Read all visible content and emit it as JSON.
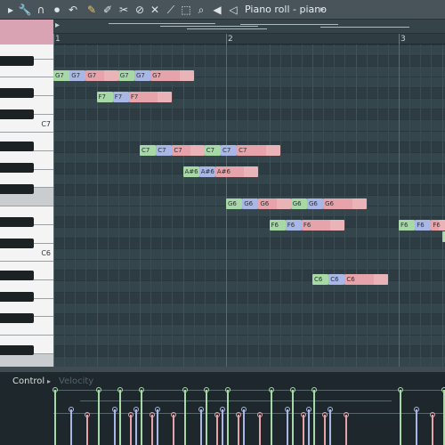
{
  "window": {
    "title": "Piano roll - piano",
    "title_arrow": "▸"
  },
  "toolbar": {
    "icons": [
      {
        "name": "menu-arrow-icon",
        "glyph": "▸"
      },
      {
        "name": "wrench-icon",
        "glyph": "🔧"
      },
      {
        "name": "magnet-icon",
        "glyph": "∩"
      },
      {
        "name": "stop-record-icon",
        "glyph": "⏺"
      },
      {
        "name": "undo-icon",
        "glyph": "↶"
      },
      {
        "name": "pencil-icon",
        "glyph": "✎"
      },
      {
        "name": "paint-brush-icon",
        "glyph": "✐"
      },
      {
        "name": "eraser-tool-icon",
        "glyph": "✂"
      },
      {
        "name": "delete-icon",
        "glyph": "⊘"
      },
      {
        "name": "mute-icon",
        "glyph": "✕"
      },
      {
        "name": "slice-icon",
        "glyph": "⟋"
      },
      {
        "name": "select-icon",
        "glyph": "⬚"
      },
      {
        "name": "zoom-icon",
        "glyph": "⌕"
      },
      {
        "name": "playback-speaker-icon",
        "glyph": "◀"
      },
      {
        "name": "speaker-icon",
        "glyph": "◁"
      }
    ]
  },
  "ruler": {
    "bars": [
      "1",
      "2",
      "3"
    ]
  },
  "keyboard": {
    "labels": {
      "c7": "C7",
      "c6": "C6"
    }
  },
  "colors": {
    "green": "#a6d9a6",
    "blue": "#a9b7e6",
    "pink": "#e6a3a9",
    "accent": "#d9a3b4"
  },
  "notes": [
    {
      "label": "G7",
      "color": "green"
    },
    {
      "label": "G7",
      "color": "blue"
    },
    {
      "label": "G7",
      "color": "pink"
    },
    {
      "label": "G7",
      "color": "green"
    },
    {
      "label": "G7",
      "color": "blue"
    },
    {
      "label": "G7",
      "color": "pink"
    },
    {
      "label": "F7",
      "color": "green"
    },
    {
      "label": "F7",
      "color": "blue"
    },
    {
      "label": "F7",
      "color": "pink"
    },
    {
      "label": "C7",
      "color": "green"
    },
    {
      "label": "C7",
      "color": "blue"
    },
    {
      "label": "C7",
      "color": "pink"
    },
    {
      "label": "C7",
      "color": "green"
    },
    {
      "label": "C7",
      "color": "blue"
    },
    {
      "label": "C7",
      "color": "pink"
    },
    {
      "label": "A#6",
      "color": "green"
    },
    {
      "label": "A#6",
      "color": "blue"
    },
    {
      "label": "A#6",
      "color": "pink"
    },
    {
      "label": "G6",
      "color": "green"
    },
    {
      "label": "G6",
      "color": "blue"
    },
    {
      "label": "G6",
      "color": "pink"
    },
    {
      "label": "G6",
      "color": "green"
    },
    {
      "label": "G6",
      "color": "blue"
    },
    {
      "label": "G6",
      "color": "pink"
    },
    {
      "label": "F6",
      "color": "green"
    },
    {
      "label": "F6",
      "color": "blue"
    },
    {
      "label": "F6",
      "color": "pink"
    },
    {
      "label": "F6",
      "color": "green"
    },
    {
      "label": "F6",
      "color": "blue"
    },
    {
      "label": "F6",
      "color": "pink"
    },
    {
      "label": "C6",
      "color": "green"
    },
    {
      "label": "C6",
      "color": "blue"
    },
    {
      "label": "C6",
      "color": "pink"
    },
    {
      "label": "",
      "color": "green"
    }
  ],
  "control": {
    "label": "Control",
    "arrow": "▸",
    "target": "Velocity"
  }
}
